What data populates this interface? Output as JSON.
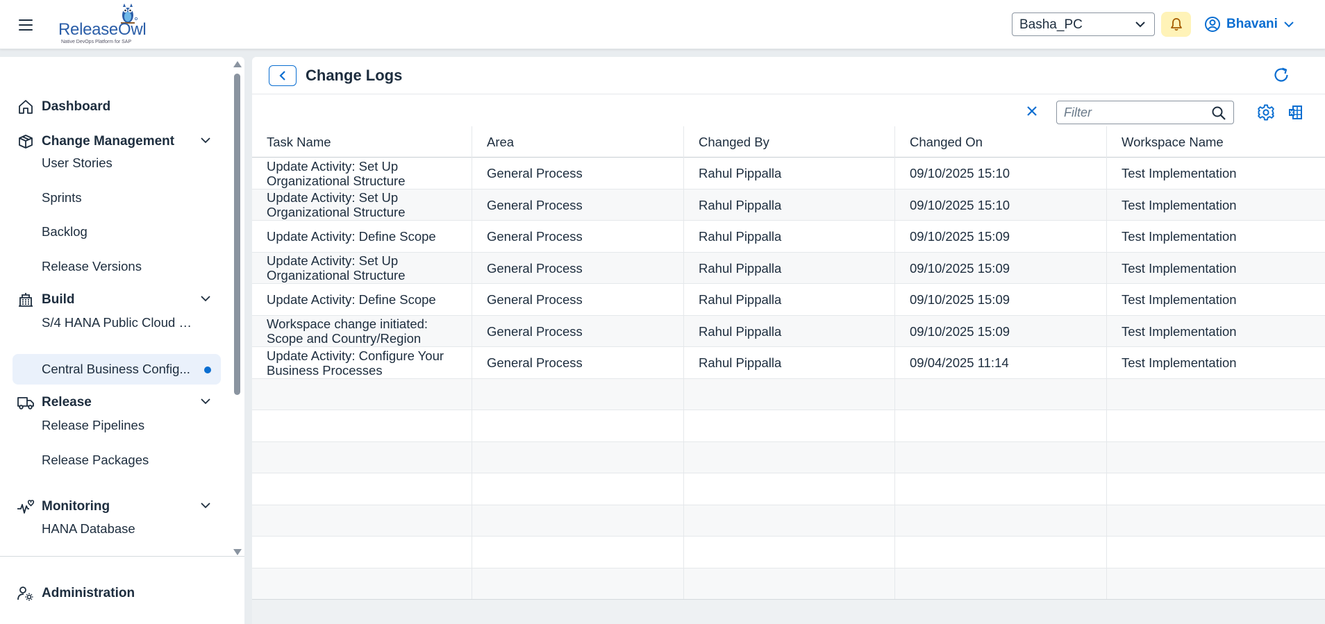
{
  "header": {
    "logo_text": "ReleaseOwl",
    "logo_tagline": "Native DevOps Platform for SAP",
    "system_selected": "Basha_PC",
    "user_name": "Bhavani",
    "accent_color": "#0a6ed1",
    "notification_bg": "#fff3b8"
  },
  "sidebar": {
    "groups": [
      {
        "label": "Dashboard",
        "icon": "home-icon"
      },
      {
        "label": "Change Management",
        "icon": "box-icon",
        "expanded": true
      },
      {
        "label": "Build",
        "icon": "building-icon",
        "expanded": true
      },
      {
        "label": "Release",
        "icon": "truck-icon",
        "expanded": true
      },
      {
        "label": "Monitoring",
        "icon": "heartbeat-icon",
        "expanded": true
      }
    ],
    "items": [
      {
        "label": "User Stories"
      },
      {
        "label": "Sprints"
      },
      {
        "label": "Backlog"
      },
      {
        "label": "Release Versions"
      },
      {
        "label": "S/4 HANA Public Cloud Ma..."
      },
      {
        "label": "Central Business Config...",
        "active": true
      },
      {
        "label": "Release Pipelines"
      },
      {
        "label": "Release Packages"
      },
      {
        "label": "HANA Database"
      }
    ],
    "admin": {
      "label": "Administration",
      "icon": "user-settings-icon"
    }
  },
  "main": {
    "title": "Change Logs",
    "filter_placeholder": "Filter",
    "table": {
      "columns": [
        "Task Name",
        "Area",
        "Changed By",
        "Changed On",
        "Workspace Name"
      ],
      "rows": [
        [
          "Update Activity: Set Up Organizational Structure",
          "General Process",
          "Rahul Pippalla",
          "09/10/2025 15:10",
          "Test Implementation"
        ],
        [
          "Update Activity: Set Up Organizational Structure",
          "General Process",
          "Rahul Pippalla",
          "09/10/2025 15:10",
          "Test Implementation"
        ],
        [
          "Update Activity: Define Scope",
          "General Process",
          "Rahul Pippalla",
          "09/10/2025 15:09",
          "Test Implementation"
        ],
        [
          "Update Activity: Set Up Organizational Structure",
          "General Process",
          "Rahul Pippalla",
          "09/10/2025 15:09",
          "Test Implementation"
        ],
        [
          "Update Activity: Define Scope",
          "General Process",
          "Rahul Pippalla",
          "09/10/2025 15:09",
          "Test Implementation"
        ],
        [
          "Workspace change initiated: Scope and Country/Region",
          "General Process",
          "Rahul Pippalla",
          "09/10/2025 15:09",
          "Test Implementation"
        ],
        [
          "Update Activity: Configure Your Business Processes",
          "General Process",
          "Rahul Pippalla",
          "09/04/2025 11:14",
          "Test Implementation"
        ]
      ]
    }
  }
}
